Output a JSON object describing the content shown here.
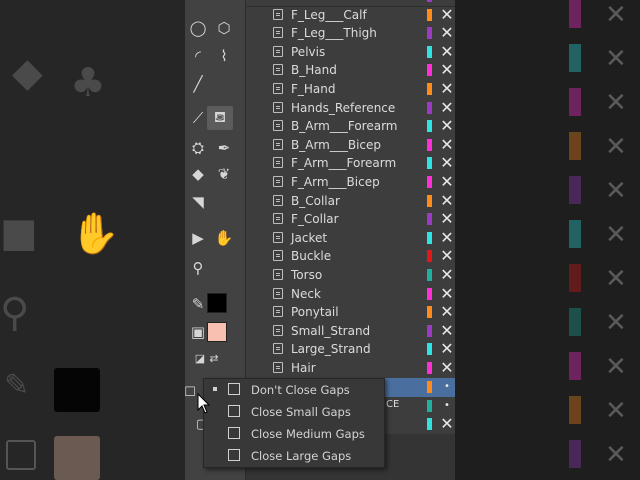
{
  "layers": [
    {
      "name": "F_Leg___Calf",
      "color": "#ff8c1a"
    },
    {
      "name": "F_Leg___Thigh",
      "color": "#9b3bc2"
    },
    {
      "name": "Pelvis",
      "color": "#2fe3e3"
    },
    {
      "name": "B_Hand",
      "color": "#ff2fd6"
    },
    {
      "name": "F_Hand",
      "color": "#ff8c1a"
    },
    {
      "name": "Hands_Reference",
      "color": "#9b3bc2"
    },
    {
      "name": "B_Arm___Forearm",
      "color": "#2fe3e3"
    },
    {
      "name": "B_Arm___Bicep",
      "color": "#ff2fd6"
    },
    {
      "name": "F_Arm___Forearm",
      "color": "#2fe3e3"
    },
    {
      "name": "F_Arm___Bicep",
      "color": "#ff2fd6"
    },
    {
      "name": "B_Collar",
      "color": "#ff8c1a"
    },
    {
      "name": "F_Collar",
      "color": "#9b3bc2"
    },
    {
      "name": "Jacket",
      "color": "#2fe3e3"
    },
    {
      "name": "Buckle",
      "color": "#e01818"
    },
    {
      "name": "Torso",
      "color": "#1fb0a0"
    },
    {
      "name": "Neck",
      "color": "#ff2fd6"
    },
    {
      "name": "Ponytail",
      "color": "#ff8c1a"
    },
    {
      "name": "Small_Strand",
      "color": "#9b3bc2"
    },
    {
      "name": "Large_Strand",
      "color": "#2fe3e3"
    },
    {
      "name": "Hair",
      "color": "#ff2fd6"
    }
  ],
  "hidden_rows": [
    {
      "name": "",
      "suffix": "",
      "color": "#ff8c1a",
      "selected": true
    },
    {
      "name": "",
      "suffix": "CE",
      "color": "#1fb0a0",
      "selected": false
    },
    {
      "name": "",
      "suffix": "",
      "color": "#2fe3e3",
      "selected": false
    }
  ],
  "gap_menu": {
    "items": [
      {
        "label": "Don't Close Gaps",
        "checked": true
      },
      {
        "label": "Close Small Gaps",
        "checked": false
      },
      {
        "label": "Close Medium Gaps",
        "checked": false
      },
      {
        "label": "Close Large Gaps",
        "checked": false
      }
    ]
  },
  "swatches": {
    "stroke": "#000000",
    "fill": "#f7c0b0"
  },
  "icons": {
    "layer": "layer-icon",
    "delete": "x-icon"
  }
}
